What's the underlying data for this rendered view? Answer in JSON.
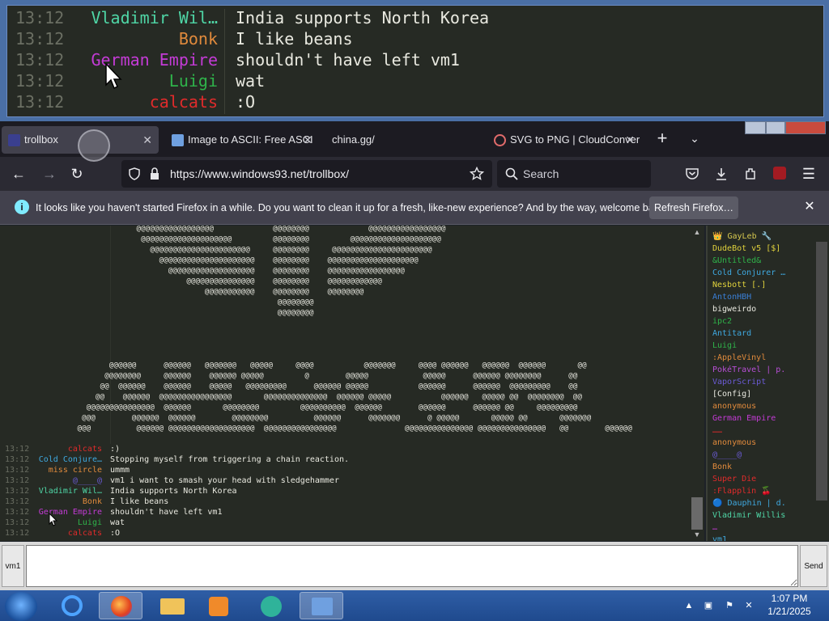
{
  "zoom_rows": [
    {
      "time": "13:12",
      "nick": "Vladimir Wil…",
      "color": "#4fd6a6",
      "msg": "India supports North Korea"
    },
    {
      "time": "13:12",
      "nick": "Bonk",
      "color": "#e08a3c",
      "msg": "I like beans"
    },
    {
      "time": "13:12",
      "nick": "German Empire",
      "color": "#c43bd6",
      "msg": "shouldn't have left vm1"
    },
    {
      "time": "13:12",
      "nick": "Luigi",
      "color": "#2fb34a",
      "msg": "wat"
    },
    {
      "time": "13:12",
      "nick": "calcats",
      "color": "#e02b2b",
      "msg": ":O"
    }
  ],
  "tabs": [
    {
      "label": "trollbox",
      "active": true
    },
    {
      "label": "Image to ASCII: Free ASCI",
      "active": false
    },
    {
      "label": "china.gg/",
      "active": false
    },
    {
      "label": "SVG to PNG | CloudConver",
      "active": false
    }
  ],
  "tab_close_glyph": "✕",
  "new_tab_glyph": "+",
  "tab_list_glyph": "⌄",
  "nav": {
    "url": "https://www.windows93.net/trollbox/",
    "search_placeholder": "Search",
    "back_glyph": "←",
    "forward_glyph": "→",
    "reload_glyph": "↻",
    "menu_glyph": "☰"
  },
  "notice": {
    "text": "It looks like you haven't started Firefox in a while. Do you want to clean it up for a fresh, like-new experience? And by the way, welcome back!",
    "button": "Refresh Firefox…",
    "close_glyph": "✕",
    "icon_glyph": "i"
  },
  "ascii_art": [
    "                              @@@@@@@@@@@@@@@@@             @@@@@@@@             @@@@@@@@@@@@@@@@@",
    "                               @@@@@@@@@@@@@@@@@@@@         @@@@@@@@         @@@@@@@@@@@@@@@@@@@@",
    "                                 @@@@@@@@@@@@@@@@@@@@@@     @@@@@@@@     @@@@@@@@@@@@@@@@@@@@@@",
    "                                   @@@@@@@@@@@@@@@@@@@@@    @@@@@@@@    @@@@@@@@@@@@@@@@@@@@",
    "                                     @@@@@@@@@@@@@@@@@@@    @@@@@@@@    @@@@@@@@@@@@@@@@@",
    "                                         @@@@@@@@@@@@@@@    @@@@@@@@    @@@@@@@@@@@@",
    "                                             @@@@@@@@@@@    @@@@@@@@    @@@@@@@@",
    "                                                             @@@@@@@@",
    "                                                             @@@@@@@@",
    "",
    "",
    "",
    "",
    "                        @@@@@@      @@@@@@   @@@@@@@   @@@@@     @@@@           @@@@@@@     @@@@ @@@@@@   @@@@@@  @@@@@@       @@",
    "                       @@@@@@@@     @@@@@@    @@@@@@ @@@@@         @        @@@@@            @@@@@      @@@@@@ @@@@@@@@      @@",
    "                      @@  @@@@@@    @@@@@@    @@@@@   @@@@@@@@@      @@@@@@ @@@@@           @@@@@@      @@@@@@  @@@@@@@@@    @@",
    "                     @@    @@@@@@  @@@@@@@@@@@@@@@@       @@@@@@@@@@@@@@  @@@@@@ @@@@@           @@@@@@   @@@@@ @@  @@@@@@@@  @@",
    "                   @@@@@@@@@@@@@@@  @@@@@@       @@@@@@@@         @@@@@@@@@@  @@@@@@        @@@@@@      @@@@@@ @@     @@@@@@@@@",
    "                  @@@        @@@@@@  @@@@@@        @@@@@@@@          @@@@@@      @@@@@@@      @ @@@@@       @@@@@ @@       @@@@@@@",
    "                 @@@          @@@@@@ @@@@@@@@@@@@@@@@@@@  @@@@@@@@@@@@@@@@               @@@@@@@@@@@@@@@ @@@@@@@@@@@@@@@   @@        @@@@@@"
  ],
  "chat_rows": [
    {
      "time": "13:12",
      "nick": "calcats",
      "color": "#e02b2b",
      "msg": ":)"
    },
    {
      "time": "13:12",
      "nick": "Cold Conjure…",
      "color": "#3fa9e0",
      "msg": "Stopping myself from triggering a chain reaction."
    },
    {
      "time": "13:12",
      "nick": "miss circle",
      "color": "#e08a3c",
      "msg": "ummm"
    },
    {
      "time": "13:12",
      "nick": "@____@",
      "color": "#6b5bd6",
      "msg": "vm1 i want to smash your head with sledgehammer"
    },
    {
      "time": "13:12",
      "nick": "Vladimir Wil…",
      "color": "#4fd6a6",
      "msg": "India supports North Korea"
    },
    {
      "time": "13:12",
      "nick": "Bonk",
      "color": "#e08a3c",
      "msg": "I like beans"
    },
    {
      "time": "13:12",
      "nick": "German Empire",
      "color": "#c43bd6",
      "msg": "shouldn't have left vm1"
    },
    {
      "time": "13:12",
      "nick": "Luigi",
      "color": "#2fb34a",
      "msg": "wat"
    },
    {
      "time": "13:12",
      "nick": "calcats",
      "color": "#e02b2b",
      "msg": ":O"
    }
  ],
  "users": [
    {
      "name": "👑 GayLeb 🔧",
      "color": "#d6c84f"
    },
    {
      "name": "DudeBot v5 [$]",
      "color": "#e0d23c"
    },
    {
      "name": "&Untitled&",
      "color": "#2fb34a"
    },
    {
      "name": "Cold Conjurer …",
      "color": "#3fa9e0"
    },
    {
      "name": "Nesbott [.]",
      "color": "#e0d23c"
    },
    {
      "name": "AntonHBH",
      "color": "#3a7fd6"
    },
    {
      "name": "bigweirdo",
      "color": "#e9e9e0"
    },
    {
      "name": "ipc2",
      "color": "#2fb34a"
    },
    {
      "name": "Antitard",
      "color": "#3fa9e0"
    },
    {
      "name": "Luigi",
      "color": "#2fb34a"
    },
    {
      "name": ":AppleVinyl",
      "color": "#e08a3c"
    },
    {
      "name": "PokéTravel | p.",
      "color": "#b84fd6"
    },
    {
      "name": "VaporScript",
      "color": "#6b5bd6"
    },
    {
      "name": "[Config]",
      "color": "#e9e9e0"
    },
    {
      "name": "anonymous",
      "color": "#e08a3c"
    },
    {
      "name": "German Empire",
      "color": "#c43bd6"
    },
    {
      "name": "……",
      "color": "#e02b2b"
    },
    {
      "name": "anonymous",
      "color": "#e08a3c"
    },
    {
      "name": "@____@",
      "color": "#6b5bd6"
    },
    {
      "name": "Bonk",
      "color": "#e08a3c"
    },
    {
      "name": "Super Die",
      "color": "#e02b2b"
    },
    {
      "name": ":Flapplin 🍒",
      "color": "#e02b2b"
    },
    {
      "name": "🔵 Dauphin | d.",
      "color": "#3fa9e0"
    },
    {
      "name": "Vladimir Willis",
      "color": "#4fd6a6"
    },
    {
      "name": "…",
      "color": "#c43bd6"
    },
    {
      "name": "vm1",
      "color": "#3fa9e0"
    }
  ],
  "input": {
    "nick_button": "vm1",
    "send_button": "Send",
    "value": ""
  },
  "taskbar": {
    "time": "1:07 PM",
    "date": "1/21/2025"
  }
}
